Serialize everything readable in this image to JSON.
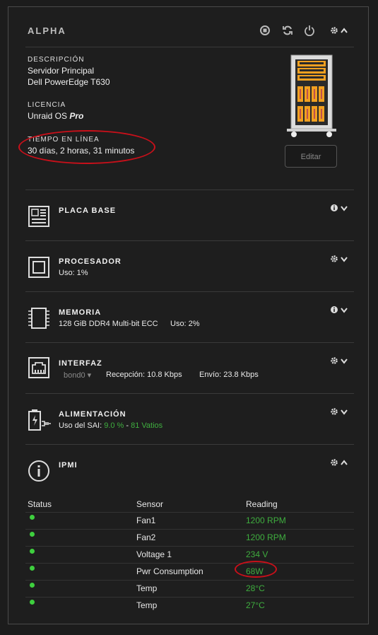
{
  "header": {
    "title": "ALPHA"
  },
  "overview": {
    "description_label": "DESCRIPCIÓN",
    "description_line1": "Servidor Principal",
    "description_line2": "Dell PowerEdge T630",
    "license_label": "LICENCIA",
    "license_value_prefix": "Unraid OS",
    "license_value_tier": "Pro",
    "uptime_label": "TIEMPO EN LÍNEA",
    "uptime_value": "30 días, 2 horas, 31 minutos",
    "edit_button": "Editar"
  },
  "sections": {
    "motherboard": {
      "title": "PLACA BASE"
    },
    "processor": {
      "title": "PROCESADOR",
      "usage": "Uso: 1%"
    },
    "memory": {
      "title": "MEMORIA",
      "spec": "128 GiB DDR4 Multi-bit ECC",
      "usage": "Uso: 2%"
    },
    "interface": {
      "title": "INTERFAZ",
      "iface": "bond0",
      "rx": "Recepción: 10.8 Kbps",
      "tx": "Envío: 23.8 Kbps"
    },
    "power": {
      "title": "ALIMENTACIÓN",
      "prefix": "Uso del SAI:",
      "percent": "9.0 %",
      "sep": " - ",
      "watts": "81 Vatios"
    },
    "ipmi": {
      "title": "IPMI"
    }
  },
  "ipmi_table": {
    "headers": [
      "Status",
      "Sensor",
      "Reading"
    ],
    "rows": [
      {
        "sensor": "Fan1",
        "reading": "1200 RPM"
      },
      {
        "sensor": "Fan2",
        "reading": "1200 RPM"
      },
      {
        "sensor": "Voltage 1",
        "reading": "234 V"
      },
      {
        "sensor": "Pwr Consumption",
        "reading": "68W"
      },
      {
        "sensor": "Temp",
        "reading": "28°C"
      },
      {
        "sensor": "Temp",
        "reading": "27°C"
      }
    ]
  },
  "colors": {
    "accent_green": "#3fae3f",
    "status_dot": "#3ecf3e",
    "highlight_red": "#c8101a",
    "server_orange": "#f0a020"
  }
}
